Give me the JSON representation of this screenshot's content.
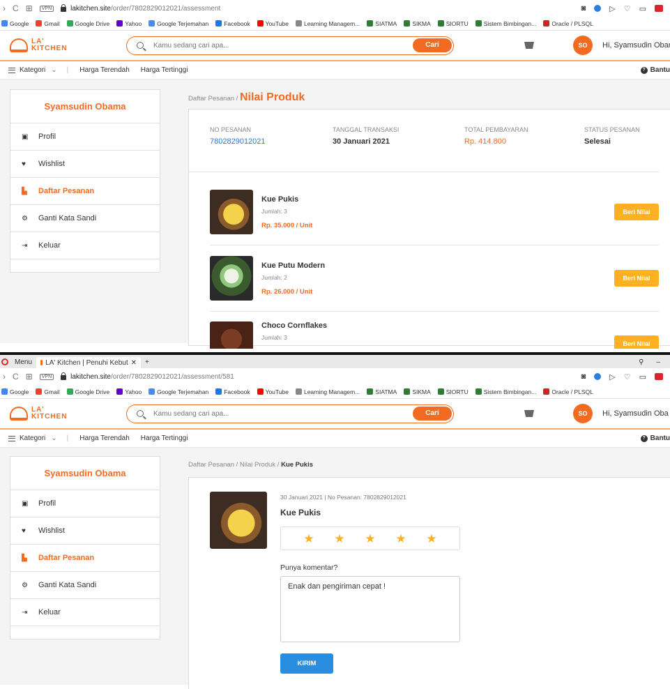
{
  "browser": {
    "menu_label": "Menu",
    "tab_title": "LA' Kitchen | Penuhi Kebut",
    "url_host_1": "lakitchen.site",
    "url_path_1": "/order/7802829012021/assessment",
    "url_host_2": "lakitchen.site",
    "url_path_2": "/order/7802829012021/assessment/581",
    "bookmarks": [
      "Google",
      "Gmail",
      "Google Drive",
      "Yahoo",
      "Google Terjemahan",
      "Facebook",
      "YouTube",
      "Learning Managem...",
      "SIATMA",
      "SIKMA",
      "SIORTU",
      "Sistem Bimbingan...",
      "Oracle / PLSQL"
    ]
  },
  "site": {
    "logo_line1": "LA'",
    "logo_line2": "KITCHEN",
    "search_placeholder": "Kamu sedang cari apa...",
    "search_button": "Cari",
    "avatar_initials": "SO",
    "greeting_1": "Hi, Syamsudin Obar",
    "greeting_2": "Hi, Syamsudin Oba",
    "category": "Kategori",
    "sort_low": "Harga Terendah",
    "sort_high": "Harga Tertinggi",
    "help": "Bantu"
  },
  "sidebar": {
    "user_name": "Syamsudin Obama",
    "items": [
      {
        "label": "Profil",
        "icon": "id-card-icon"
      },
      {
        "label": "Wishlist",
        "icon": "heart-icon"
      },
      {
        "label": "Daftar Pesanan",
        "icon": "orders-icon"
      },
      {
        "label": "Ganti Kata Sandi",
        "icon": "gears-icon"
      },
      {
        "label": "Keluar",
        "icon": "sign-out-icon"
      }
    ],
    "active_index": 2
  },
  "page1": {
    "crumb_parent": "Daftar Pesanan /",
    "crumb_current": "Nilai Produk",
    "order": {
      "no_label": "NO PESANAN",
      "no_value": "7802829012021",
      "date_label": "TANGGAL TRANSAKSI",
      "date_value": "30 Januari 2021",
      "total_label": "TOTAL PEMBAYARAN",
      "total_value": "Rp. 414.800",
      "status_label": "STATUS PESANAN",
      "status_value": "Selesai"
    },
    "products": [
      {
        "name": "Kue Pukis",
        "qty": "Jumlah: 3",
        "price": "Rp. 35.000 / Unit",
        "action": "Beri Nilai"
      },
      {
        "name": "Kue Putu Modern",
        "qty": "Jumlah: 2",
        "price": "Rp. 26.000 / Unit",
        "action": "Beri Nilai"
      },
      {
        "name": "Choco Cornflakes",
        "qty": "Jumlah: 3",
        "price": "",
        "action": "Beri Nilai"
      }
    ]
  },
  "page2": {
    "crumb_parent": "Daftar Pesanan / Nilai Produk /",
    "crumb_current": "Kue Pukis",
    "meta": "30 Januari 2021 | No Pesanan: 7802829012021",
    "product_name": "Kue Pukis",
    "rating": 5,
    "comment_label": "Punya komentar?",
    "comment_value": "Enak dan pengiriman cepat !",
    "submit": "KIRIM"
  },
  "colors": {
    "brand": "#f26b21",
    "rate_button": "#fdb022",
    "submit": "#2a8ee0",
    "link_blue": "#2a7bd2"
  }
}
